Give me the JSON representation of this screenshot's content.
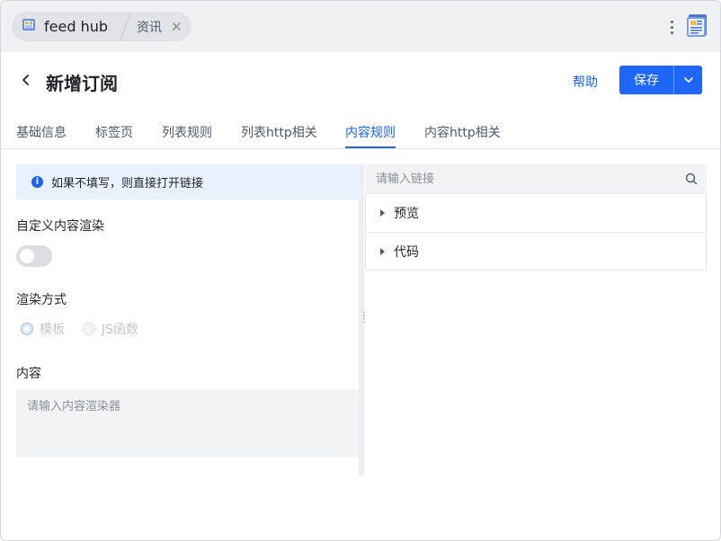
{
  "tabbar": {
    "app_title": "feed hub",
    "sub_tab": "资讯",
    "close_glyph": "✕"
  },
  "header": {
    "back_glyph": "‹",
    "title": "新增订阅",
    "help": "帮助",
    "save": "保存"
  },
  "tabs": [
    {
      "label": "基础信息",
      "active": false
    },
    {
      "label": "标签页",
      "active": false
    },
    {
      "label": "列表规则",
      "active": false
    },
    {
      "label": "列表http相关",
      "active": false
    },
    {
      "label": "内容规则",
      "active": true
    },
    {
      "label": "内容http相关",
      "active": false
    }
  ],
  "left": {
    "alert_icon": "i",
    "alert_text": "如果不填写，则直接打开链接",
    "custom_render_label": "自定义内容渲染",
    "custom_render_enabled": false,
    "render_mode_label": "渲染方式",
    "render_options": [
      {
        "label": "模板",
        "checked": true
      },
      {
        "label": "JS函数",
        "checked": false
      }
    ],
    "content_label": "内容",
    "content_placeholder": "请输入内容渲染器",
    "content_value": ""
  },
  "right": {
    "search_placeholder": "请输入链接",
    "panels": [
      {
        "label": "预览"
      },
      {
        "label": "代码"
      }
    ]
  },
  "colors": {
    "accent": "#1e63e9",
    "primary_button": "#1e66f5",
    "alert_bg": "#e8f1fe"
  },
  "icons": [
    "feed-hub-app-icon",
    "close-icon",
    "more-vertical-icon",
    "newspaper-icon",
    "back-arrow-icon",
    "chevron-down-icon",
    "info-icon",
    "search-icon",
    "caret-right-icon",
    "drag-grip-icon"
  ]
}
